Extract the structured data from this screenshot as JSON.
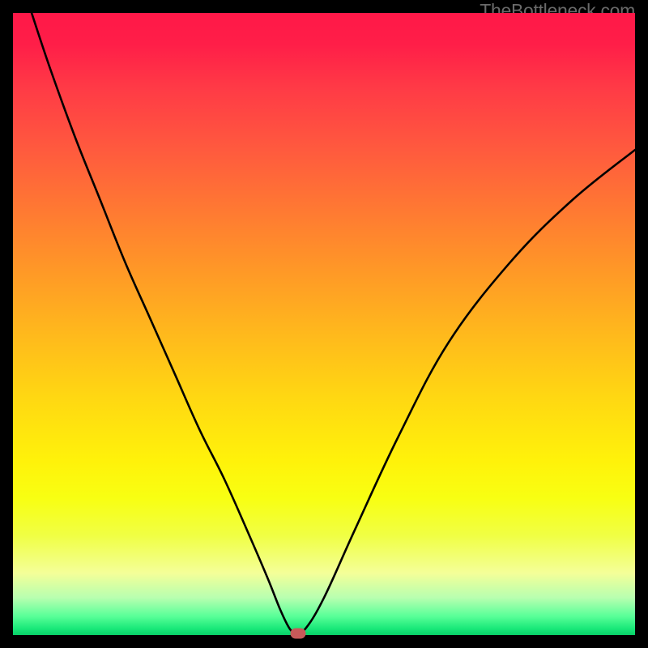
{
  "watermark": "TheBottleneck.com",
  "chart_data": {
    "type": "line",
    "title": "",
    "xlabel": "",
    "ylabel": "",
    "xlim": [
      0,
      100
    ],
    "ylim": [
      0,
      100
    ],
    "grid": false,
    "legend": false,
    "gradient": {
      "top_color": "#ff1848",
      "bottom_color": "#08d068",
      "description": "vertical red-to-green heat gradient"
    },
    "series": [
      {
        "name": "bottleneck-curve",
        "color": "#000000",
        "x": [
          3,
          6,
          10,
          14,
          18,
          22,
          26,
          30,
          34,
          38,
          41,
          43,
          44.5,
          45.5,
          47,
          50,
          55,
          62,
          70,
          80,
          90,
          100
        ],
        "y": [
          100,
          91,
          80,
          70,
          60,
          51,
          42,
          33,
          25,
          16,
          9,
          4,
          1,
          0.5,
          1,
          6,
          17,
          32,
          47,
          60,
          70,
          78
        ]
      }
    ],
    "marker": {
      "name": "optimal-point",
      "x": 45.8,
      "y": 0.2,
      "color": "#c85a5a",
      "shape": "pill"
    }
  }
}
